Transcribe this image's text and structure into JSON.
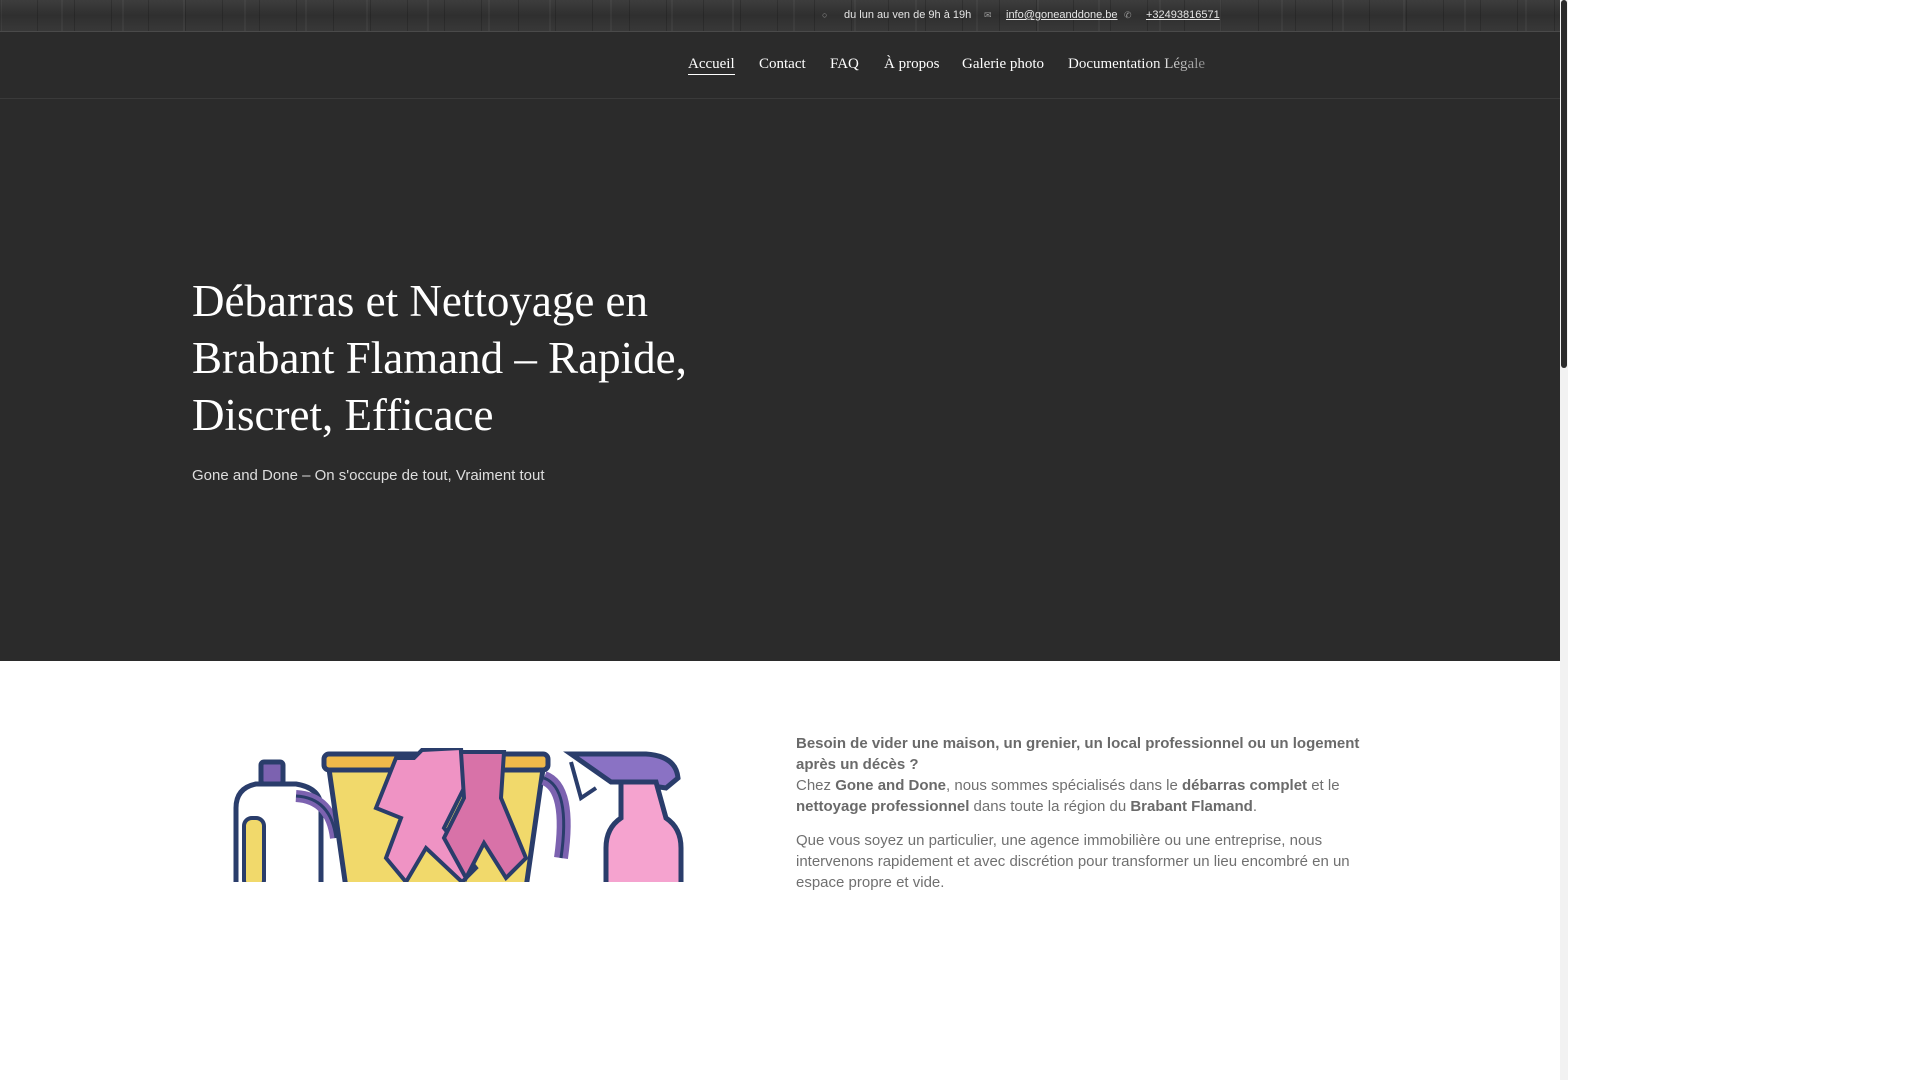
{
  "topbar": {
    "hours": "du lun au ven de 9h à 19h",
    "email": "info@goneanddone.be",
    "phone": "+32493816571"
  },
  "nav": {
    "items": [
      {
        "label": "Accueil"
      },
      {
        "label": "Contact"
      },
      {
        "label": "FAQ"
      },
      {
        "label": "À propos"
      },
      {
        "label": "Galerie photo"
      },
      {
        "label": "Documentation Légale"
      }
    ]
  },
  "hero": {
    "title": "Débarras et Nettoyage en Brabant Flamand – Rapide, Discret, Efficace",
    "subtitle": "Gone and Done – On s'occupe de tout, Vraiment tout"
  },
  "content": {
    "question": "Besoin de vider une maison, un grenier, un local professionnel ou un logement après un décès ?",
    "intro_1": "Chez ",
    "brand": "Gone and Done",
    "intro_2": ", nous sommes spécialisés dans le ",
    "service_1": "débarras complet",
    "intro_3": " et le ",
    "service_2": "nettoyage professionnel",
    "intro_4": " dans toute la région du ",
    "region": "Brabant Flamand",
    "intro_5": ".",
    "paragraph_2": "Que vous soyez un particulier, une agence immobilière ou une entreprise, nous intervenons rapidement et avec discrétion pour transformer un lieu encombré en un espace propre et vide."
  },
  "icons": {
    "hours": "clock-icon",
    "email": "envelope-icon",
    "phone": "phone-icon",
    "illustration": "cleaning-supplies-illustration"
  }
}
